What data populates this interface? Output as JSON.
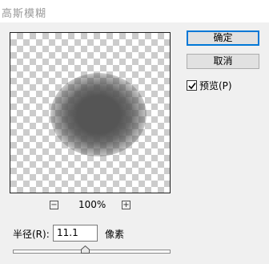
{
  "window": {
    "title": "高斯模糊"
  },
  "buttons": {
    "ok_label": "确定",
    "cancel_label": "取消"
  },
  "preview_toggle": {
    "label": "预览(P)",
    "checked": true
  },
  "zoom": {
    "minus_label": "−",
    "value": "100%",
    "plus_label": "+"
  },
  "radius": {
    "label": "半径(R):",
    "value": "11.1",
    "unit": "像素",
    "slider_fraction": 0.46
  },
  "colors": {
    "accent": "#0078d7",
    "blur_color": "#555555"
  }
}
